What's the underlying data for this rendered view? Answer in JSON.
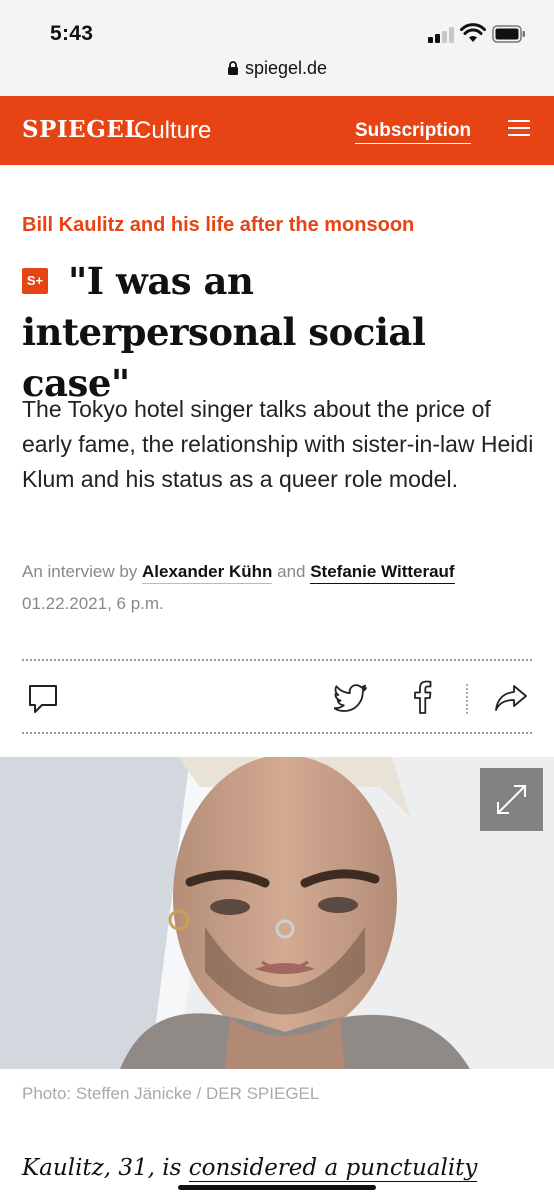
{
  "status_bar": {
    "time": "5:43",
    "url": "spiegel.de"
  },
  "header": {
    "brand": "SPIEGEL",
    "section": "Culture",
    "subscription_label": "Subscription"
  },
  "article": {
    "kicker": "Bill Kaulitz and his life after the monsoon",
    "badge": "S+",
    "headline": "\"I was an interpersonal social case\"",
    "teaser": "The Tokyo hotel singer talks about the price of early fame, the relationship with sister-in-law Heidi Klum and his status as a queer role model.",
    "byline_prefix": "An interview by",
    "author1": "Alexander Kühn",
    "byline_and": "and",
    "author2": "Stefanie Witterauf",
    "date": "01.22.2021, 6 p.m.",
    "photo_caption": "Photo: Steffen Jänicke / DER SPIEGEL",
    "body_start": "Kaulitz, 31, is",
    "body_link": "considered a punctuality"
  },
  "icons": {
    "comment": "comment-icon",
    "twitter": "twitter-icon",
    "facebook": "facebook-icon",
    "share": "share-icon",
    "expand": "expand-icon",
    "menu": "menu-icon"
  },
  "colors": {
    "brand": "#e64415",
    "text": "#111111",
    "muted": "#888888"
  }
}
